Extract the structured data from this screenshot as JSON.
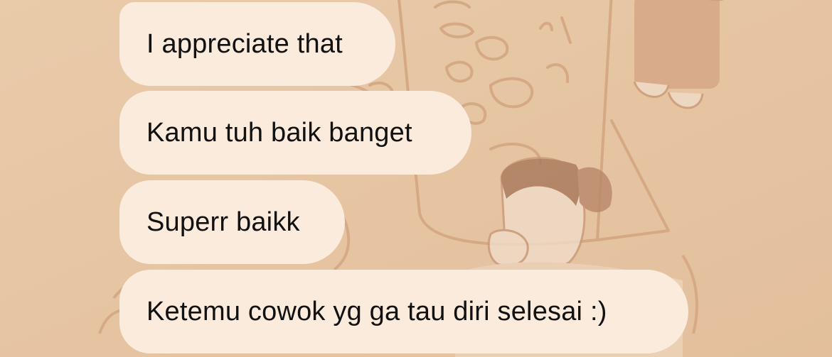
{
  "chat": {
    "bubble_color": "#fbebdd",
    "wallpaper_color": "#e7c7a6",
    "messages": [
      {
        "text": "I appreciate that"
      },
      {
        "text": "Kamu tuh baik banget"
      },
      {
        "text": "Superr baikk"
      },
      {
        "text": "Ketemu cowok yg ga tau diri selesai :)"
      }
    ]
  }
}
